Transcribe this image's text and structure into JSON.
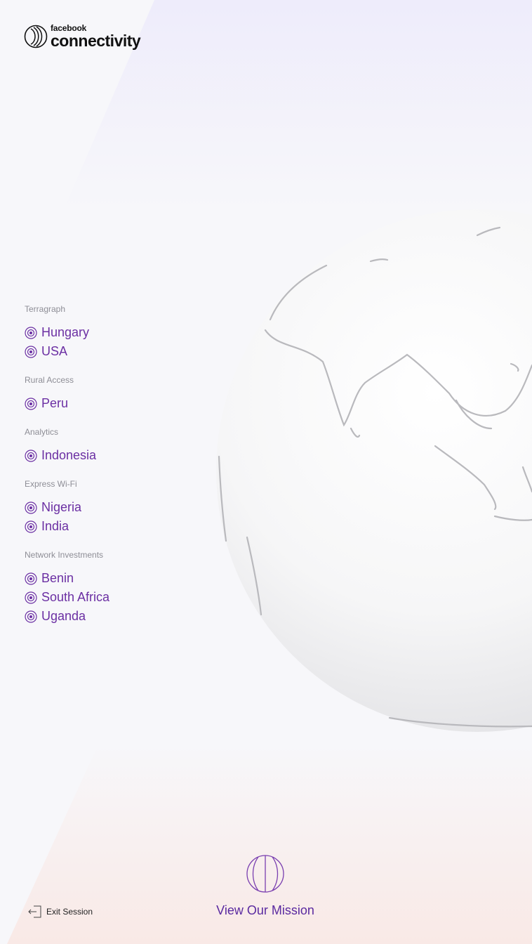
{
  "brand": {
    "small": "facebook",
    "product": "connectivity"
  },
  "sections": [
    {
      "title": "Terragraph",
      "items": [
        "Hungary",
        "USA"
      ]
    },
    {
      "title": "Rural Access",
      "items": [
        "Peru"
      ]
    },
    {
      "title": "Analytics",
      "items": [
        "Indonesia"
      ]
    },
    {
      "title": "Express Wi-Fi",
      "items": [
        "Nigeria",
        "India"
      ]
    },
    {
      "title": "Network Investments",
      "items": [
        "Benin",
        "South Africa",
        "Uganda"
      ]
    }
  ],
  "footer": {
    "mission_label": "View Our Mission",
    "exit_label": "Exit Session"
  },
  "icons": {
    "logo": "connectivity-logo-icon",
    "item": "target-radio-icon",
    "mission": "basketball-globe-icon",
    "exit": "exit-door-icon",
    "globe": "earth-globe"
  },
  "colors": {
    "accent": "#6b2fa3",
    "section_title": "#8e8e96",
    "background": "#f7f7fa"
  }
}
